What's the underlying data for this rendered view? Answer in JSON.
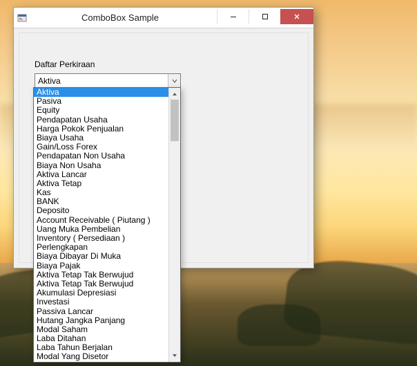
{
  "window": {
    "title": "ComboBox Sample"
  },
  "form": {
    "label": "Daftar Perkiraan",
    "combo_value": "Aktiva"
  },
  "dropdown": {
    "selected_index": 0,
    "items": [
      "Aktiva",
      "Pasiva",
      "Equity",
      "Pendapatan Usaha",
      "Harga Pokok Penjualan",
      "Biaya Usaha",
      "Gain/Loss Forex",
      "Pendapatan Non Usaha",
      "Biaya Non Usaha",
      "Aktiva Lancar",
      "Aktiva Tetap",
      "Kas",
      "BANK",
      "Deposito",
      "Account Receivable ( Piutang )",
      "Uang Muka Pembelian",
      "Inventory ( Persediaan )",
      "Perlengkapan",
      "Biaya Dibayar Di Muka",
      "Biaya Pajak",
      "Aktiva Tetap Tak Berwujud",
      "Aktiva Tetap Tak Berwujud",
      "Akumulasi Depresiasi",
      "Investasi",
      "Passiva Lancar",
      "Hutang Jangka Panjang",
      "Modal Saham",
      "Laba Ditahan",
      "Laba Tahun Berjalan",
      "Modal Yang Disetor"
    ]
  }
}
